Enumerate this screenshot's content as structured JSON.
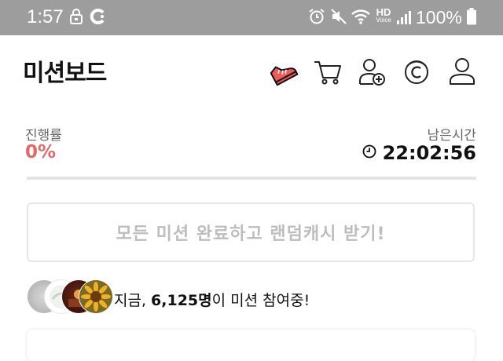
{
  "status_bar": {
    "time": "1:57",
    "battery": "100%",
    "hd_label": "HD",
    "voice_label": "Voice",
    "icons": [
      "lock-icon",
      "app-c-icon",
      "alarm-icon",
      "mute-icon",
      "wifi-icon",
      "signal-icon",
      "battery-icon"
    ]
  },
  "header": {
    "title": "미션보드",
    "icons": [
      "sneaker-icon",
      "cart-icon",
      "add-friend-icon",
      "coin-c-icon",
      "profile-icon"
    ]
  },
  "progress": {
    "label": "진행률",
    "value": "0%"
  },
  "remaining": {
    "label": "남은시간",
    "value": "22:02:56"
  },
  "reward_button": {
    "label": "모든 미션 완료하고 랜덤캐시 받기!"
  },
  "participants": {
    "prefix": "지금, ",
    "count": "6,125명",
    "suffix": "이 미션 참여중!"
  },
  "colors": {
    "accent": "#e06a6a",
    "status_bar": "#9d9d9d",
    "muted_text": "#bdbdbd"
  }
}
